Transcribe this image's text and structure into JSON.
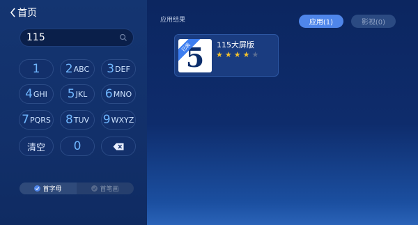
{
  "nav": {
    "back_label": "首页"
  },
  "search": {
    "query": "115"
  },
  "keypad": {
    "keys": [
      {
        "num": "1",
        "letters": ""
      },
      {
        "num": "2",
        "letters": "ABC"
      },
      {
        "num": "3",
        "letters": "DEF"
      },
      {
        "num": "4",
        "letters": "GHI"
      },
      {
        "num": "5",
        "letters": "JKL"
      },
      {
        "num": "6",
        "letters": "MNO"
      },
      {
        "num": "7",
        "letters": "PQRS"
      },
      {
        "num": "8",
        "letters": "TUV"
      },
      {
        "num": "9",
        "letters": "WXYZ"
      }
    ],
    "clear_label": "清空",
    "zero": "0"
  },
  "input_mode": {
    "options": [
      {
        "label": "首字母",
        "selected": true
      },
      {
        "label": "首笔画",
        "selected": false
      }
    ]
  },
  "results": {
    "section_label": "应用结果",
    "tabs": [
      {
        "label": "应用(1)",
        "active": true
      },
      {
        "label": "影视(0)",
        "active": false
      }
    ],
    "apps": [
      {
        "title": "115大屏版",
        "badge": "已装",
        "icon_glyph": "5",
        "rating": 4,
        "max_rating": 5
      }
    ]
  },
  "colors": {
    "accent": "#4f86ea",
    "key_number": "#6fb6ff",
    "star": "#f2c12e"
  }
}
